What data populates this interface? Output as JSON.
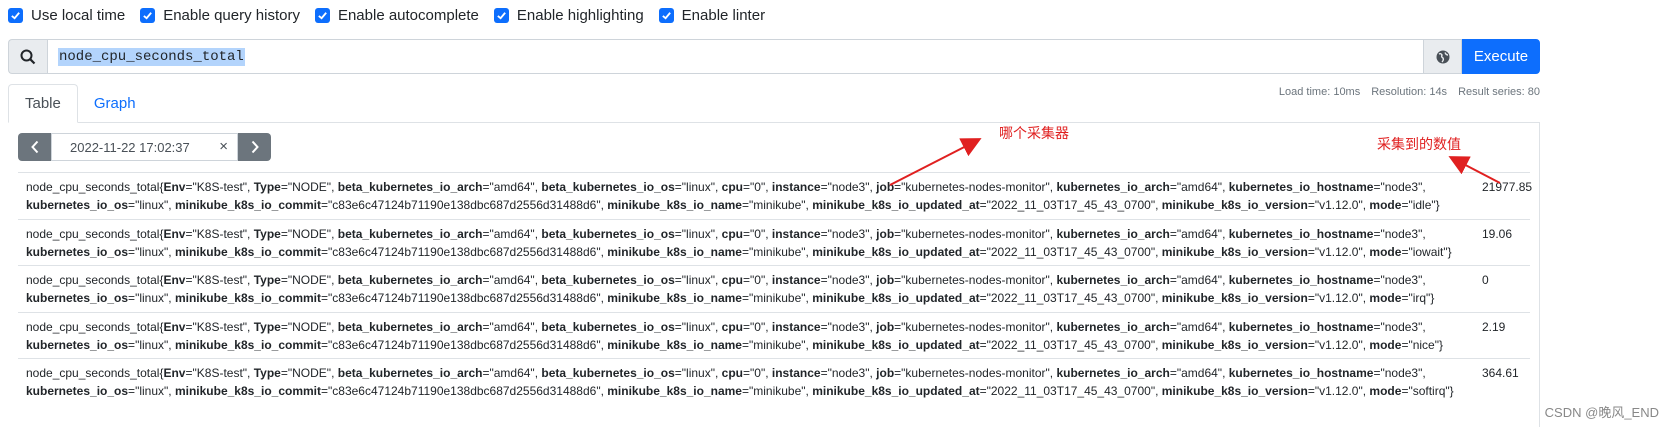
{
  "options": [
    {
      "label": "Use local time",
      "checked": true
    },
    {
      "label": "Enable query history",
      "checked": true
    },
    {
      "label": "Enable autocomplete",
      "checked": true
    },
    {
      "label": "Enable highlighting",
      "checked": true
    },
    {
      "label": "Enable linter",
      "checked": true
    }
  ],
  "search": {
    "query": "node_cpu_seconds_total",
    "execute_label": "Execute"
  },
  "tabs": [
    {
      "label": "Table",
      "active": true
    },
    {
      "label": "Graph",
      "active": false
    }
  ],
  "stats": {
    "load_time": "Load time: 10ms",
    "resolution": "Resolution: 14s",
    "result_series": "Result series: 80"
  },
  "time_nav": {
    "datetime": "2022-11-22 17:02:37",
    "clear": "×"
  },
  "series_common": {
    "metric": "node_cpu_seconds_total",
    "labels_line1": [
      {
        "k": "Env",
        "v": "\"K8S-test\""
      },
      {
        "k": "Type",
        "v": "\"NODE\""
      },
      {
        "k": "beta_kubernetes_io_arch",
        "v": "\"amd64\""
      },
      {
        "k": "beta_kubernetes_io_os",
        "v": "\"linux\""
      },
      {
        "k": "cpu",
        "v": "\"0\""
      },
      {
        "k": "instance",
        "v": "\"node3\""
      },
      {
        "k": "job",
        "v": "\"kubernetes-nodes-monitor\""
      },
      {
        "k": "kubernetes_io_arch",
        "v": "\"amd64\""
      },
      {
        "k": "kubernetes_io_hostname",
        "v": "\"node3\""
      }
    ],
    "labels_line2": [
      {
        "k": "kubernetes_io_os",
        "v": "\"linux\""
      },
      {
        "k": "minikube_k8s_io_commit",
        "v": "\"c83e6c47124b71190e138dbc687d2556d31488d6\""
      },
      {
        "k": "minikube_k8s_io_name",
        "v": "\"minikube\""
      },
      {
        "k": "minikube_k8s_io_updated_at",
        "v": "\"2022_11_03T17_45_43_0700\""
      },
      {
        "k": "minikube_k8s_io_version",
        "v": "\"v1.12.0\""
      }
    ]
  },
  "rows": [
    {
      "mode": "\"idle\"",
      "value": "21977.85"
    },
    {
      "mode": "\"iowait\"",
      "value": "19.06"
    },
    {
      "mode": "\"irq\"",
      "value": "0"
    },
    {
      "mode": "\"nice\"",
      "value": "2.19"
    },
    {
      "mode": "\"softirq\"",
      "value": "364.61"
    }
  ],
  "annotations": {
    "collector": "哪个采集器",
    "value": "采集到的数值",
    "color": "#e02020"
  },
  "watermark": "CSDN @晚风_END",
  "colors": {
    "primary": "#0d6efd",
    "secondary": "#6c757d"
  }
}
